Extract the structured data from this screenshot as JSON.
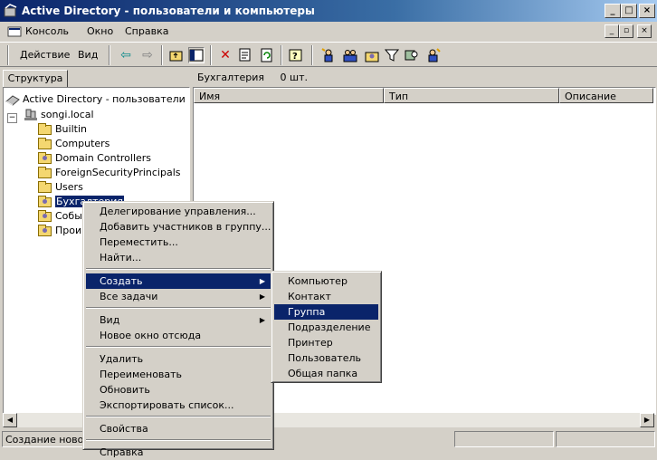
{
  "window": {
    "title": "Active Directory - пользователи и компьютеры",
    "minimize": "_",
    "maximize": "□",
    "close": "×"
  },
  "menubar": {
    "items": [
      "Консоль",
      "Окно",
      "Справка"
    ],
    "mdi": [
      "_",
      "▫",
      "×"
    ]
  },
  "toolbar": {
    "action": "Действие",
    "view": "Вид"
  },
  "left_pane": {
    "tab": "Структура",
    "root": "Active Directory - пользователи и ко",
    "domain": "songi.local",
    "expander": "−",
    "containers": [
      "Builtin",
      "Computers",
      "Domain Controllers",
      "ForeignSecurityPrincipals",
      "Users",
      "Бухгалтерия",
      "Событ",
      "Прои"
    ]
  },
  "right_pane": {
    "header_title": "Бухгалтерия",
    "header_count": "0 шт.",
    "columns": [
      "Имя",
      "Тип",
      "Описание"
    ]
  },
  "statusbar": {
    "text": "Создание нового"
  },
  "context_menu": {
    "items": [
      "Делегирование управления...",
      "Добавить участников в группу...",
      "Переместить...",
      "Найти...",
      "Создать",
      "Все задачи",
      "Вид",
      "Новое окно отсюда",
      "Удалить",
      "Переименовать",
      "Обновить",
      "Экспортировать список...",
      "Свойства",
      "Справка"
    ]
  },
  "submenu": {
    "items": [
      "Компьютер",
      "Контакт",
      "Группа",
      "Подразделение",
      "Принтер",
      "Пользователь",
      "Общая папка"
    ]
  },
  "colors": {
    "title_active": "#0a246a",
    "highlight": "#0a246a",
    "face": "#d4d0c8"
  }
}
